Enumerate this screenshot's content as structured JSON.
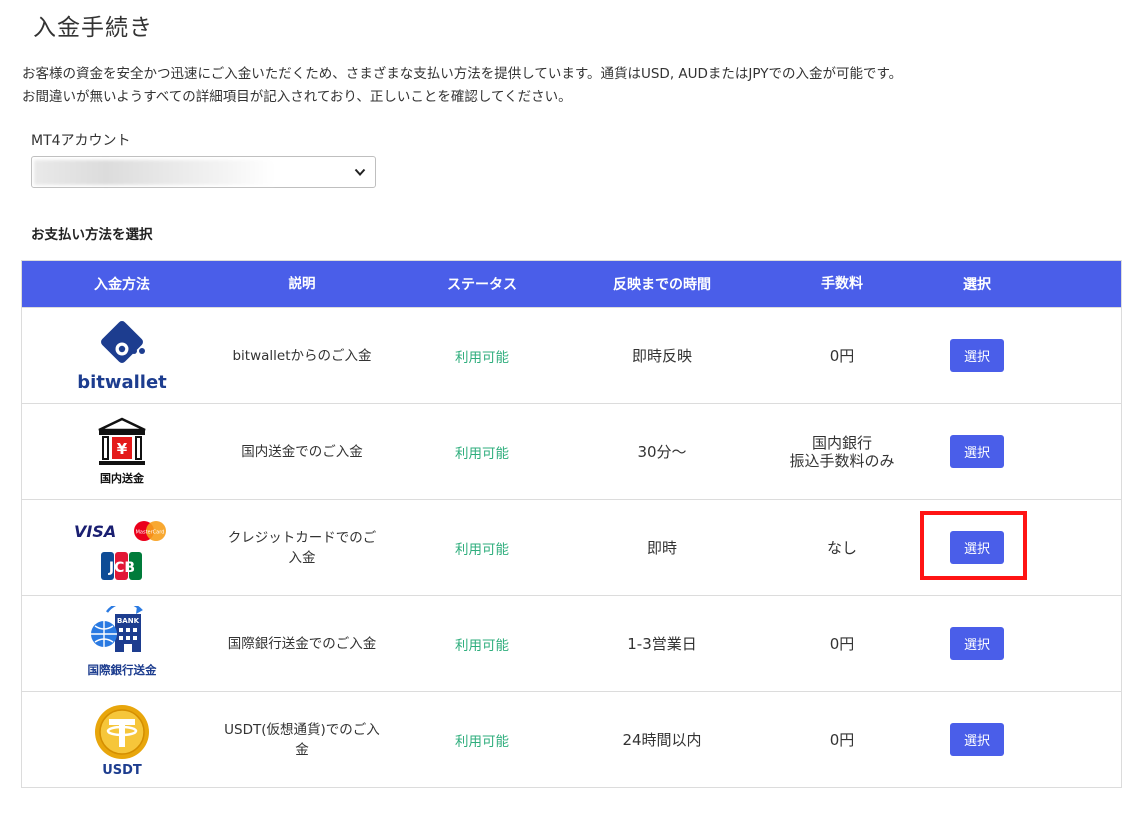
{
  "page": {
    "title": "入金手続き",
    "intro_line1": "お客様の資金を安全かつ迅速にご入金いただくため、さまざまな支払い方法を提供しています。通貨はUSD, AUDまたはJPYでの入金が可能です。",
    "intro_line2": "お間違いが無いようすべての詳細項目が記入されており、正しいことを確認してください。"
  },
  "account": {
    "label": "MT4アカウント"
  },
  "payment": {
    "section_title": "お支払い方法を選択",
    "headers": [
      "入金方法",
      "説明",
      "ステータス",
      "反映までの時間",
      "手数料",
      "選択"
    ],
    "rows": [
      {
        "logo": "bitwallet",
        "logo_text": "bitwallet",
        "description": "bitwalletからのご入金",
        "status": "利用可能",
        "time": "即時反映",
        "fee": "0円",
        "fee2": "",
        "button": "選択"
      },
      {
        "logo": "bank-yen",
        "logo_text": "国内送金",
        "description": "国内送金でのご入金",
        "status": "利用可能",
        "time": "30分〜",
        "fee": "国内銀行",
        "fee2": "振込手数料のみ",
        "button": "選択"
      },
      {
        "logo": "cards",
        "logo_text": "VISA",
        "logo_text2": "MasterCard",
        "logo_text3": "JCB",
        "description": "クレジットカードでのご入金",
        "status": "利用可能",
        "time": "即時",
        "fee": "なし",
        "fee2": "",
        "button": "選択"
      },
      {
        "logo": "intl-bank",
        "logo_text": "国際銀行送金",
        "logo_text2": "BANK",
        "description": "国際銀行送金でのご入金",
        "status": "利用可能",
        "time": "1-3営業日",
        "fee": "0円",
        "fee2": "",
        "button": "選択"
      },
      {
        "logo": "usdt",
        "logo_text": "USDT",
        "description": "USDT(仮想通貨)でのご入金",
        "status": "利用可能",
        "time": "24時間以内",
        "fee": "0円",
        "fee2": "",
        "button": "選択"
      }
    ]
  },
  "colors": {
    "header_bg": "#4a5ee9",
    "button_bg": "#4a5ee9",
    "status_green": "#2fae7d",
    "highlight_red": "#ff1414",
    "bitwallet_blue": "#1d3d8f"
  }
}
